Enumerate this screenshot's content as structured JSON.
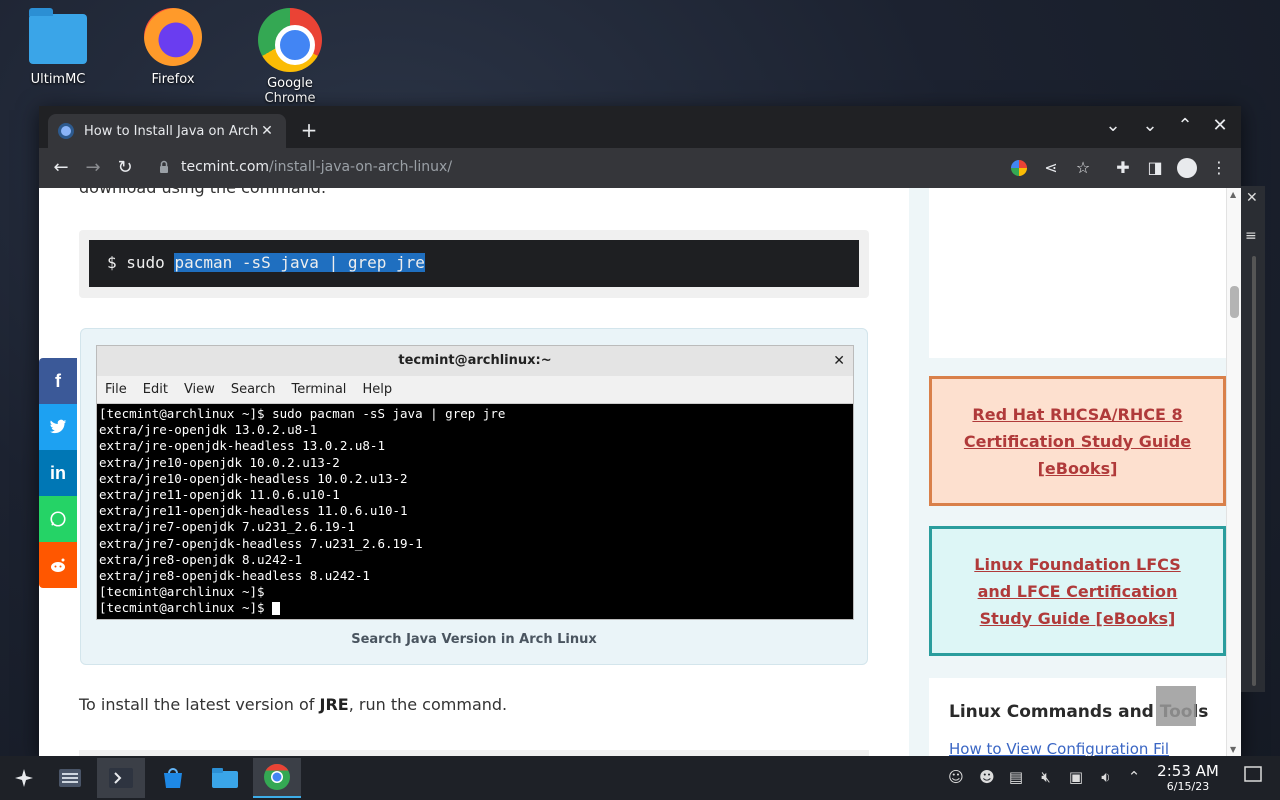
{
  "desktop": {
    "icons": [
      {
        "label": "UltimMC"
      },
      {
        "label": "Firefox"
      },
      {
        "label": "Google Chrome"
      }
    ]
  },
  "browser": {
    "tab_title": "How to Install Java on Arch Li",
    "url_domain": "tecmint.com",
    "url_path": "/install-java-on-arch-linux/",
    "new_tab": "+",
    "tab_close": "✕"
  },
  "article": {
    "cut_text": "download using the command.",
    "code_prefix": "$ sudo ",
    "code_selected": "pacman -sS java | grep jre",
    "terminal": {
      "title": "tecmint@archlinux:~",
      "menu": [
        "File",
        "Edit",
        "View",
        "Search",
        "Terminal",
        "Help"
      ],
      "lines": [
        "[tecmint@archlinux ~]$ sudo pacman -sS java | grep jre",
        "extra/jre-openjdk 13.0.2.u8-1",
        "extra/jre-openjdk-headless 13.0.2.u8-1",
        "extra/jre10-openjdk 10.0.2.u13-2",
        "extra/jre10-openjdk-headless 10.0.2.u13-2",
        "extra/jre11-openjdk 11.0.6.u10-1",
        "extra/jre11-openjdk-headless 11.0.6.u10-1",
        "extra/jre7-openjdk 7.u231_2.6.19-1",
        "extra/jre7-openjdk-headless 7.u231_2.6.19-1",
        "extra/jre8-openjdk 8.u242-1",
        "extra/jre8-openjdk-headless 8.u242-1",
        "[tecmint@archlinux ~]$",
        "[tecmint@archlinux ~]$ "
      ]
    },
    "caption": "Search Java Version in Arch Linux",
    "para_before": "To install the latest version of ",
    "para_bold": "JRE",
    "para_after": ", run the command."
  },
  "social": [
    "f",
    "t",
    "in",
    "w",
    "r"
  ],
  "sidebar": {
    "promo1": "Red Hat RHCSA/RHCE 8 Certification Study Guide [eBooks]",
    "promo2": "Linux Foundation LFCS and LFCE Certification Study Guide [eBooks]",
    "card_title": "Linux Commands and Tools",
    "card_link": "How to View Configuration Fil"
  },
  "taskbar": {
    "time": "2:53 AM",
    "date": "6/15/23"
  },
  "colors": {
    "promo1_border": "#d9804a",
    "promo2_border": "#2a9d9d",
    "selection": "#1f6fc0",
    "facebook": "#3b5998",
    "twitter": "#1da1f2",
    "linkedin": "#0077b5",
    "whatsapp": "#25d366",
    "reddit": "#ff5700"
  }
}
